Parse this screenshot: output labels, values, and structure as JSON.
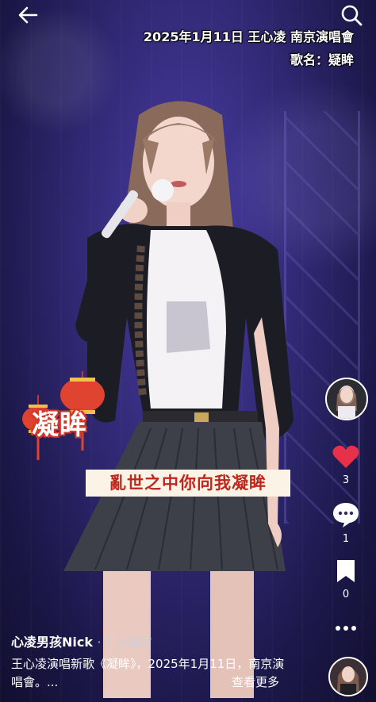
{
  "overlay": {
    "caption_line1": "2025年1月11日 王心凌 南京演唱會",
    "caption_line2": "歌名：疑眸",
    "lantern_text": "凝眸",
    "lyric": "亂世之中你向我凝眸"
  },
  "actions": {
    "like_count": "3",
    "comment_count": "1",
    "save_count": "0"
  },
  "post": {
    "author": "心凌男孩Nick",
    "time": "· 7 分鐘前",
    "description": "王心凌演唱新歌《凝眸》，2025年1月11日，南京演唱會。...",
    "see_more": "查看更多"
  },
  "colors": {
    "like_red": "#e8304a",
    "lyric_red": "#c0261c",
    "stage_purple": "#2f2770"
  },
  "icons": [
    "back-arrow-icon",
    "search-icon",
    "heart-icon",
    "comment-icon",
    "bookmark-icon",
    "more-icon"
  ]
}
